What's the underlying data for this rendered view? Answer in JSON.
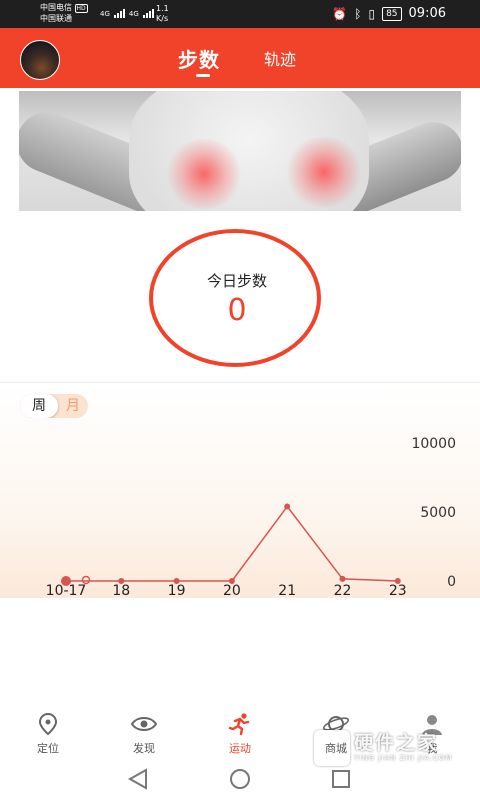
{
  "status_bar": {
    "carrier1": "中国电信",
    "hd_badge": "HD",
    "carrier2": "中国联通",
    "net1": "4G",
    "net2": "4G",
    "speed_value": "1.1",
    "speed_unit": "K/s",
    "battery": "85",
    "time": "09:06"
  },
  "header": {
    "tabs": [
      {
        "label": "步数",
        "active": true
      },
      {
        "label": "轨迹",
        "active": false
      }
    ],
    "accent_color": "#f1432a"
  },
  "today": {
    "label": "今日步数",
    "value": "0"
  },
  "period_toggle": {
    "week_label": "周",
    "month_label": "月",
    "selected": "周"
  },
  "chart_data": {
    "type": "line",
    "categories": [
      "10-17",
      "18",
      "19",
      "20",
      "21",
      "22",
      "23"
    ],
    "series": [
      {
        "values": [
          0,
          0,
          0,
          0,
          5400,
          150,
          0
        ]
      }
    ],
    "y_ticks": [
      "10000",
      "5000",
      "0"
    ],
    "ylim": [
      0,
      10000
    ],
    "grid": false,
    "line_color": "#d9534f",
    "selected_index": 0
  },
  "bottom_nav": [
    {
      "label": "定位",
      "icon": "location-pin-icon",
      "active": false
    },
    {
      "label": "发现",
      "icon": "eye-icon",
      "active": false
    },
    {
      "label": "运动",
      "icon": "running-icon",
      "active": true
    },
    {
      "label": "商城",
      "icon": "planet-icon",
      "active": false
    },
    {
      "label": "我",
      "icon": "user-icon",
      "active": false
    }
  ],
  "watermark": {
    "main": "硬件之家",
    "sub": "YING JIAN ZHI JIA.COM"
  }
}
